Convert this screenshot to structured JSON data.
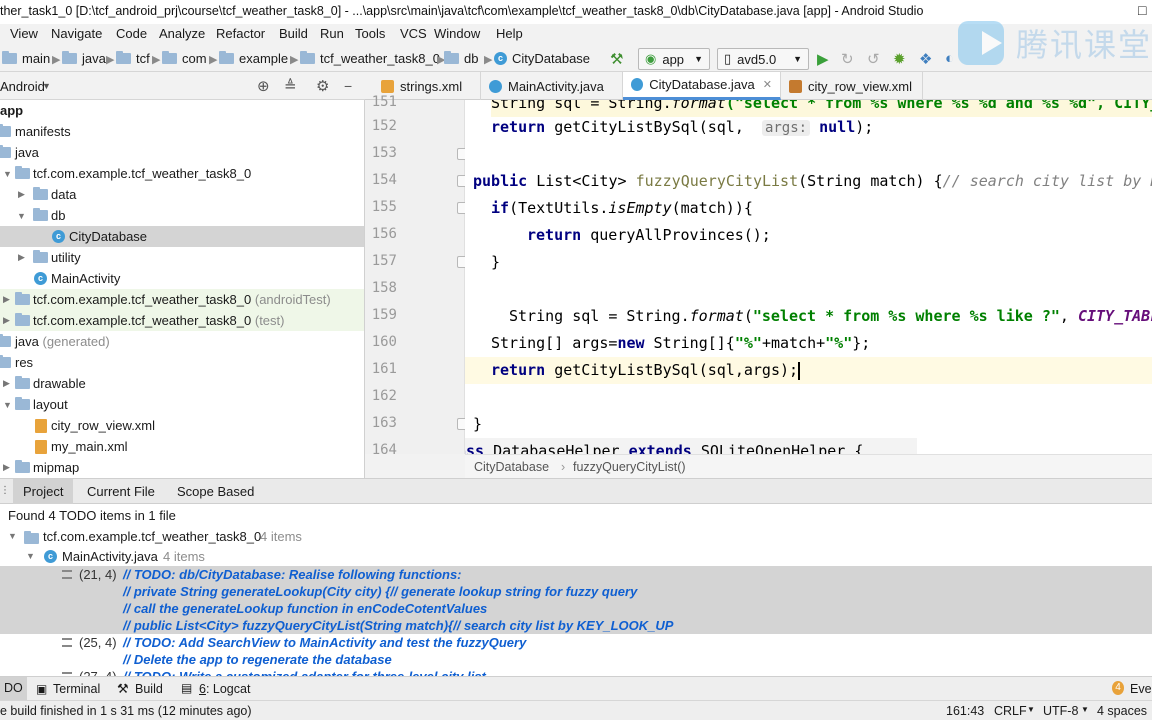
{
  "window": {
    "title": "ther_task1_0 [D:\\tcf_android_prj\\course\\tcf_weather_task8_0] - ...\\app\\src\\main\\java\\tcf\\com\\example\\tcf_weather_task8_0\\db\\CityDatabase.java [app] - Android Studio",
    "watermark": "腾讯课堂"
  },
  "menu": [
    "View",
    "Navigate",
    "Code",
    "Analyze",
    "Refactor",
    "Build",
    "Run",
    "Tools",
    "VCS",
    "Window",
    "Help"
  ],
  "nav": {
    "crumbs": [
      "main",
      "java",
      "tcf",
      "com",
      "example",
      "tcf_weather_task8_0",
      "db",
      "CityDatabase"
    ],
    "run_config": "app",
    "device": "avd5.0"
  },
  "project": {
    "view_mode": "Android",
    "tree": [
      {
        "label": "app",
        "extra": ""
      },
      {
        "label": "manifests",
        "extra": ""
      },
      {
        "label": "java",
        "extra": ""
      },
      {
        "label": "tcf.com.example.tcf_weather_task8_0",
        "extra": ""
      },
      {
        "label": "data",
        "extra": ""
      },
      {
        "label": "db",
        "extra": ""
      },
      {
        "label": "CityDatabase",
        "extra": ""
      },
      {
        "label": "utility",
        "extra": ""
      },
      {
        "label": "MainActivity",
        "extra": ""
      },
      {
        "label": "tcf.com.example.tcf_weather_task8_0",
        "extra": "(androidTest)"
      },
      {
        "label": "tcf.com.example.tcf_weather_task8_0",
        "extra": "(test)"
      },
      {
        "label": "java",
        "extra": "(generated)"
      },
      {
        "label": "res",
        "extra": ""
      },
      {
        "label": "drawable",
        "extra": ""
      },
      {
        "label": "layout",
        "extra": ""
      },
      {
        "label": "city_row_view.xml",
        "extra": ""
      },
      {
        "label": "my_main.xml",
        "extra": ""
      },
      {
        "label": "mipmap",
        "extra": ""
      }
    ]
  },
  "editor": {
    "tabs": [
      "strings.xml",
      "MainActivity.java",
      "CityDatabase.java",
      "city_row_view.xml"
    ],
    "line_numbers": [
      "151",
      "152",
      "153",
      "154",
      "155",
      "156",
      "157",
      "158",
      "159",
      "160",
      "161",
      "162",
      "163",
      "164"
    ],
    "code": {
      "l151a": "String sql = String.",
      "l151b": "format",
      "l151c": "(\"select * from %s where %s %d and %s %d\", CITY_",
      "l152a": "return",
      "l152b": " getCityListBySql(sql,  ",
      "l152c": "args:",
      "l152d": "null",
      "l152e": ");",
      "l154a": "public",
      "l154b": " List<City> ",
      "l154c": "fuzzyQueryCityList",
      "l154d": "(String match) {",
      "l154e": "// search city list by K",
      "l155a": "if",
      "l155b": "(TextUtils.",
      "l155c": "isEmpty",
      "l155d": "(match)){",
      "l156a": "return",
      "l156b": " queryAllProvinces();",
      "l157": "}",
      "l159a": "String sql = String.",
      "l159b": "format",
      "l159c": "(",
      "l159d": "\"select * from %s where %s like ?\"",
      "l159e": ", ",
      "l159f": "CITY_TABLE",
      "l160a": "String[] args=",
      "l160b": "new",
      "l160c": " String[]{",
      "l160d": "\"%\"",
      "l160e": "+match+",
      "l160f": "\"%\"",
      "l160g": "};",
      "l161a": "return",
      "l161b": " getCityListBySql(sql,args);",
      "l163": "}",
      "l164a": "ass ",
      "l164b": "DatabaseHelper ",
      "l164c": "extends",
      "l164d": " SQLiteOpenHelper {"
    },
    "breadcrumb": [
      "CityDatabase",
      "fuzzyQueryCityList()"
    ]
  },
  "todo": {
    "tabs": [
      "Project",
      "Current File",
      "Scope Based"
    ],
    "summary": "Found 4 TODO items in 1 file",
    "package": "tcf.com.example.tcf_weather_task8_0",
    "package_count": "4 items",
    "file": "MainActivity.java",
    "file_count": "4 items",
    "items": [
      {
        "pos": "(21, 4)",
        "text": "// TODO: db/CityDatabase: Realise following functions:"
      },
      {
        "pos": "",
        "text": "//  private String generateLookup(City city)  {// generate lookup string for fuzzy query"
      },
      {
        "pos": "",
        "text": "//  call the generateLookup function in enCodeCotentValues"
      },
      {
        "pos": "",
        "text": "//  public List<City> fuzzyQueryCityList(String match){// search city list by KEY_LOOK_UP"
      },
      {
        "pos": "(25, 4)",
        "text": "// TODO: Add SearchView to MainActivity and test the fuzzyQuery"
      },
      {
        "pos": "",
        "text": "//   Delete the app to regenerate the database"
      },
      {
        "pos": "(27, 4)",
        "text": "// TODO: Write a customized adapter for three-level city list"
      }
    ]
  },
  "toolstrip": {
    "todo": "DO",
    "terminal": "Terminal",
    "build": "Build",
    "logcat_num": "6",
    "logcat": ": Logcat",
    "event_count": "4",
    "event": "Ever"
  },
  "status": {
    "message": "e build finished in 1 s 31 ms (12 minutes ago)",
    "position": "161:43",
    "line_sep": "CRLF",
    "encoding": "UTF-8",
    "indent": "4 spaces"
  }
}
